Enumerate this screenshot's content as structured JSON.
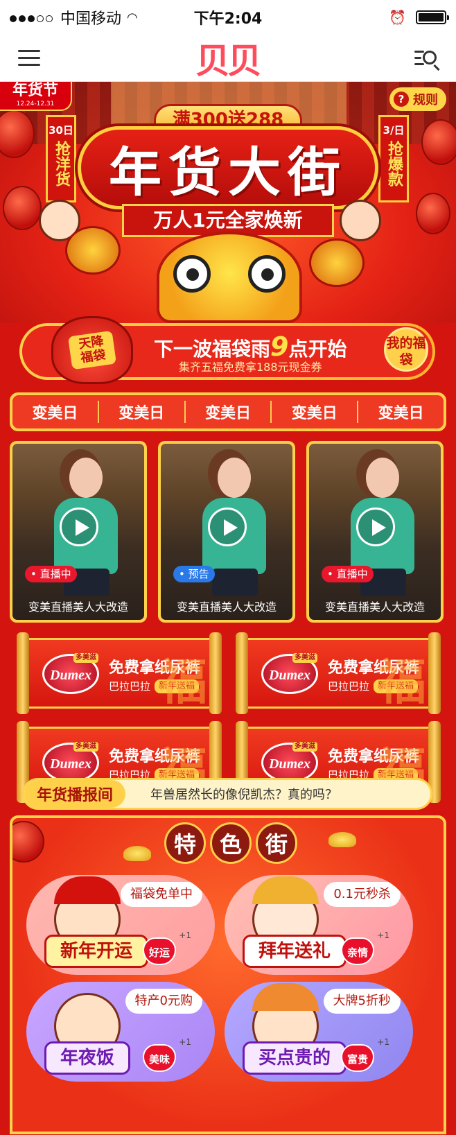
{
  "status_bar": {
    "carrier": "中国移动",
    "time": "下午2:04"
  },
  "nav": {
    "logo": "贝贝"
  },
  "hero": {
    "festival_badge": "年货节",
    "festival_dates": "12.24-12.31",
    "rules": "规则",
    "promo_top": "满300送288",
    "left_tag_date": "30日",
    "left_tag_text": "抢洋货",
    "right_tag_date": "3/日",
    "right_tag_text": "抢爆款",
    "title": "年货大街",
    "subtitle": "万人1元全家焕新"
  },
  "lucky_bag": {
    "bag_label": "天降福袋",
    "title_prefix": "下一波福袋雨",
    "title_num": "9",
    "title_suffix": "点开始",
    "subtitle": "集齐五福免费拿188元现金券",
    "my_bag": "我的福袋"
  },
  "tabs": [
    "变美日",
    "变美日",
    "变美日",
    "变美日",
    "变美日"
  ],
  "videos": [
    {
      "tag": "直播中",
      "status": "live",
      "caption": "变美直播美人大改造"
    },
    {
      "tag": "预告",
      "status": "pre",
      "caption": "变美直播美人大改造"
    },
    {
      "tag": "直播中",
      "status": "live",
      "caption": "变美直播美人大改造"
    }
  ],
  "promos": [
    {
      "brand": "Dumex",
      "brand_cn": "多美滋",
      "title": "免费拿纸尿裤",
      "sub": "巴拉巴拉",
      "tag": "新年送福",
      "mark": "福"
    },
    {
      "brand": "Dumex",
      "brand_cn": "多美滋",
      "title": "免费拿纸尿裤",
      "sub": "巴拉巴拉",
      "tag": "新年送福",
      "mark": "福"
    },
    {
      "brand": "Dumex",
      "brand_cn": "多美滋",
      "title": "免费拿纸尿裤",
      "sub": "巴拉巴拉",
      "tag": "新年送福",
      "mark": "福"
    },
    {
      "brand": "Dumex",
      "brand_cn": "多美滋",
      "title": "免费拿纸尿裤",
      "sub": "巴拉巴拉",
      "tag": "新年送福",
      "mark": "福"
    }
  ],
  "ticker": {
    "label": "年货播报间",
    "text": "年兽居然长的像倪凯杰？真的吗？"
  },
  "street": {
    "title": [
      "特",
      "色",
      "街"
    ],
    "zones": [
      {
        "label": "新年开运",
        "bubble": "福袋免单中",
        "heart": "好运",
        "plus": "+1"
      },
      {
        "label": "拜年送礼",
        "bubble": "0.1元秒杀",
        "heart": "亲情",
        "plus": "+1"
      },
      {
        "label": "年夜饭",
        "bubble": "特产0元购",
        "heart": "美味",
        "plus": "+1"
      },
      {
        "label": "买点贵的",
        "bubble": "大牌5折秒",
        "heart": "富贵",
        "plus": "+1"
      }
    ]
  }
}
